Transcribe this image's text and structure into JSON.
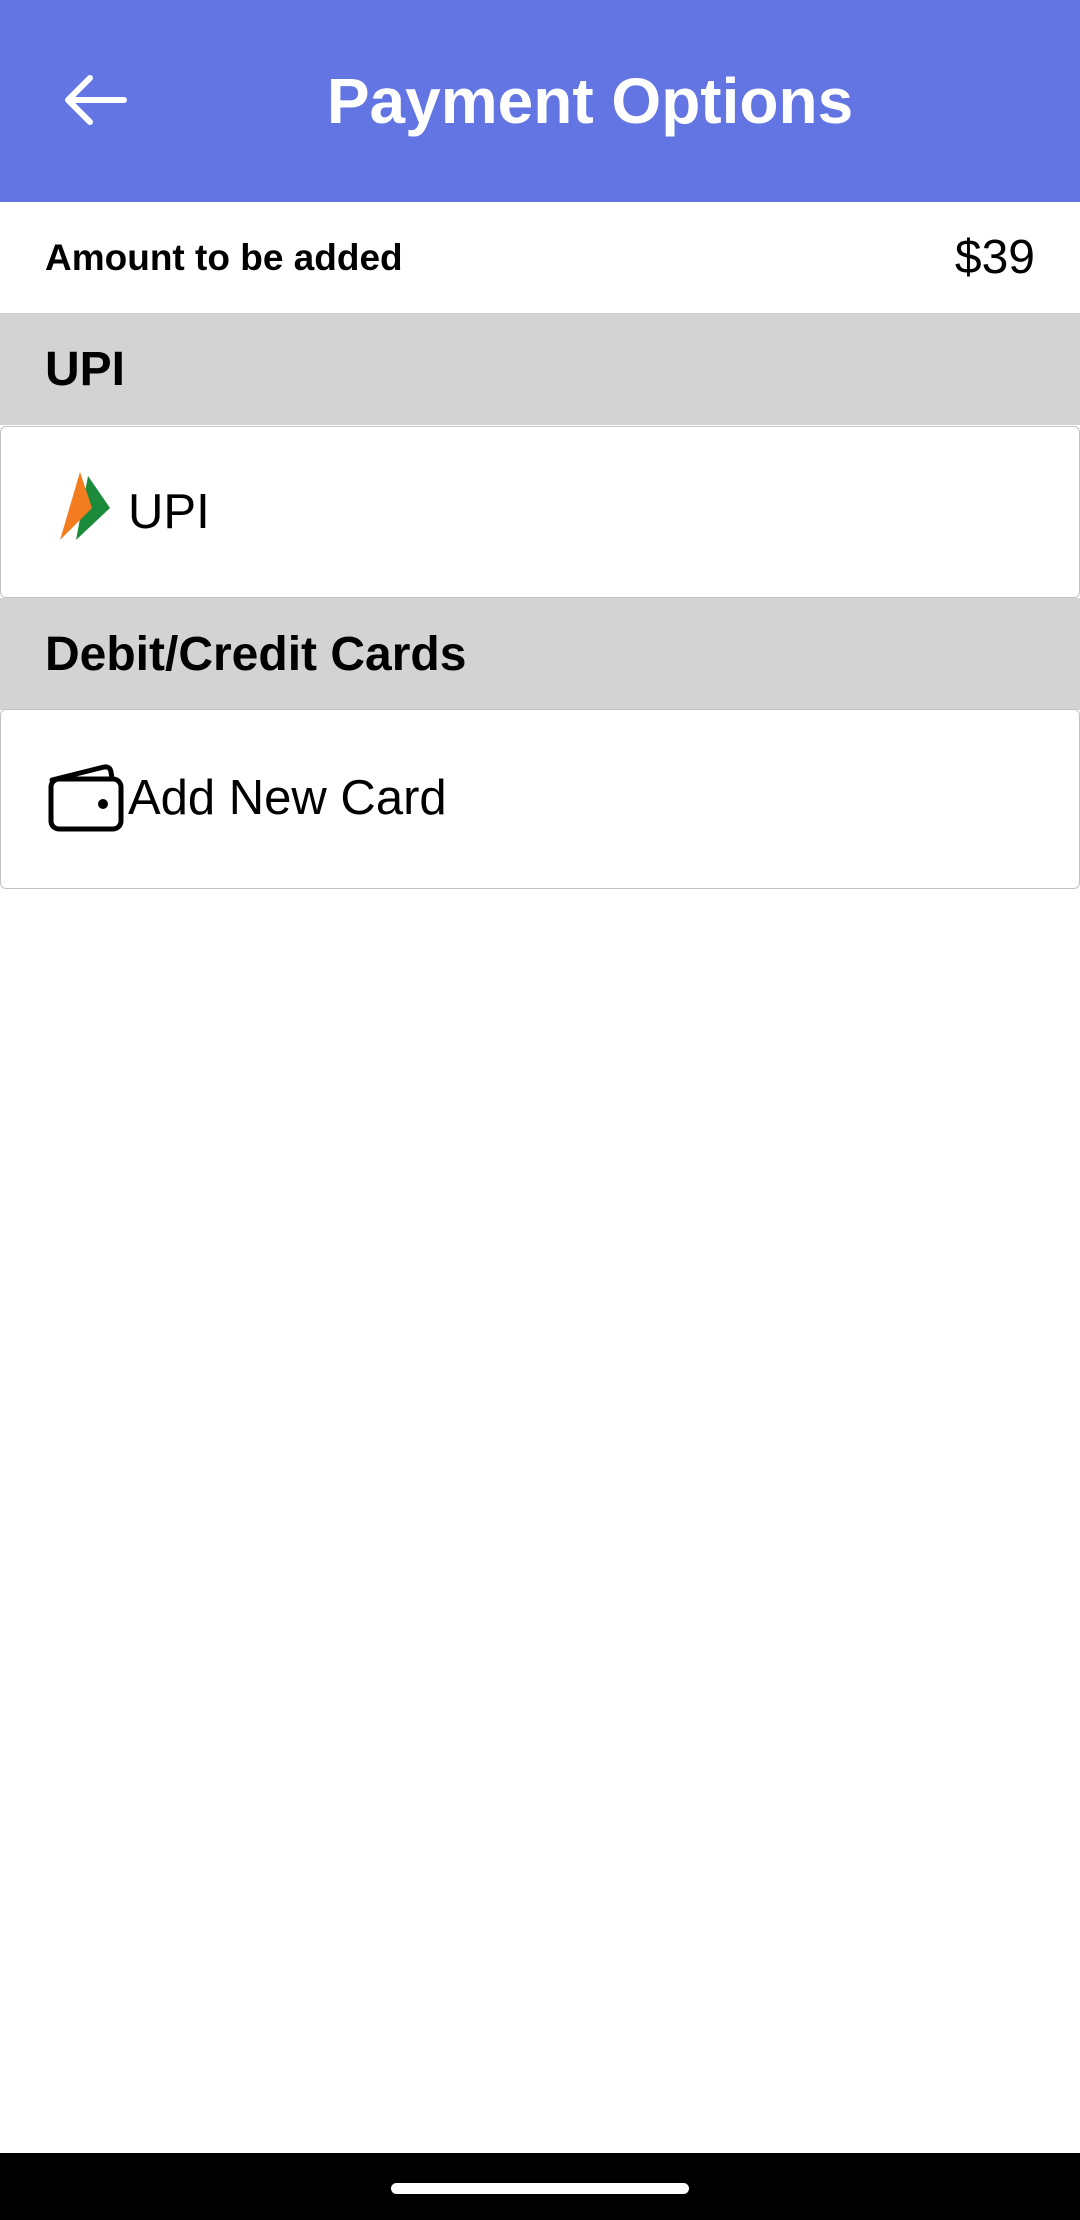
{
  "app_bar": {
    "title": "Payment Options",
    "back_icon": "arrow-left-icon",
    "color": "#6275E3"
  },
  "amount": {
    "label": "Amount to be added",
    "value": "$39"
  },
  "sections": {
    "upi": {
      "header": "UPI",
      "option_label": "UPI",
      "option_icon": "upi-logo-icon"
    },
    "cards": {
      "header": "Debit/Credit Cards",
      "option_label": "Add New Card",
      "option_icon": "wallet-icon"
    }
  },
  "colors": {
    "section_header_bg": "#D3D3D3",
    "upi_orange": "#F47C20",
    "upi_green": "#1B8A3A"
  }
}
